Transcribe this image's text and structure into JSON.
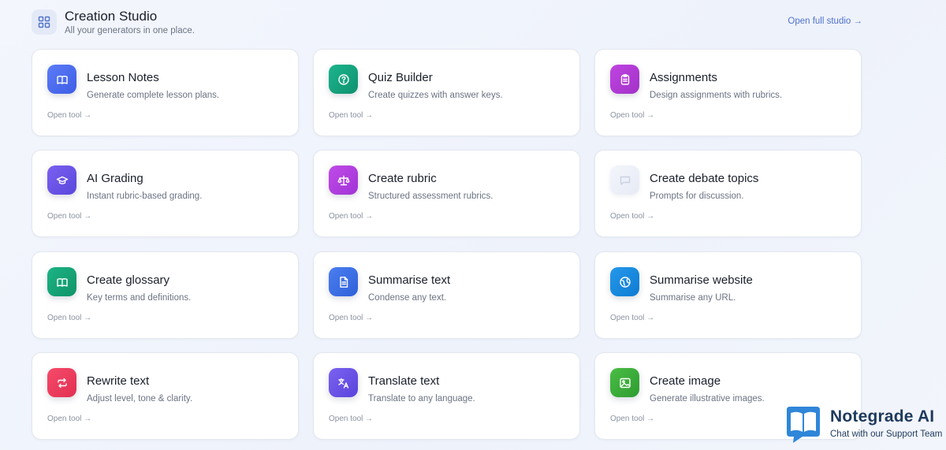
{
  "header": {
    "icon": "grid-icon",
    "title": "Creation Studio",
    "subtitle": "All your generators in one place.",
    "link": "Open full studio →"
  },
  "cards": [
    {
      "title": "Lesson Notes",
      "desc": "Generate complete lesson plans.",
      "cta": "Open tool →",
      "icon": "book-open-icon",
      "color": "#4f6ff0"
    },
    {
      "title": "Quiz Builder",
      "desc": "Create quizzes with answer keys.",
      "cta": "Open tool →",
      "icon": "help-circle-icon",
      "color": "#14a37f"
    },
    {
      "title": "Assignments",
      "desc": "Design assignments with rubrics.",
      "cta": "Open tool →",
      "icon": "clipboard-icon",
      "color": "#b23fd6"
    },
    {
      "title": "AI Grading",
      "desc": "Instant rubric-based grading.",
      "cta": "Open tool →",
      "icon": "graduation-cap-icon",
      "color": "#6a55e8"
    },
    {
      "title": "Create rubric",
      "desc": "Structured assessment rubrics.",
      "cta": "Open tool →",
      "icon": "scale-icon",
      "color": "#b23fe0"
    },
    {
      "title": "Create debate topics",
      "desc": "Prompts for discussion.",
      "cta": "Open tool →",
      "icon": "message-square-icon",
      "color": "#eef1f8"
    },
    {
      "title": "Create glossary",
      "desc": "Key terms and definitions.",
      "cta": "Open tool →",
      "icon": "book-open-icon",
      "color": "#15a376"
    },
    {
      "title": "Summarise text",
      "desc": "Condense any text.",
      "cta": "Open tool →",
      "icon": "file-text-icon",
      "color": "#3b6fe6"
    },
    {
      "title": "Summarise website",
      "desc": "Summarise any URL.",
      "cta": "Open tool →",
      "icon": "globe-icon",
      "color": "#1689df"
    },
    {
      "title": "Rewrite text",
      "desc": "Adjust level, tone & clarity.",
      "cta": "Open tool →",
      "icon": "repeat-icon",
      "color": "#ee3c5e"
    },
    {
      "title": "Translate text",
      "desc": "Translate to any language.",
      "cta": "Open tool →",
      "icon": "languages-icon",
      "color": "#6a52e6"
    },
    {
      "title": "Create image",
      "desc": "Generate illustrative images.",
      "cta": "Open tool →",
      "icon": "image-icon",
      "color": "#3aae3c"
    }
  ],
  "brand": {
    "name": "Notegrade AI",
    "tagline": "Chat with our Support Team",
    "logo": "book-chat-logo"
  }
}
